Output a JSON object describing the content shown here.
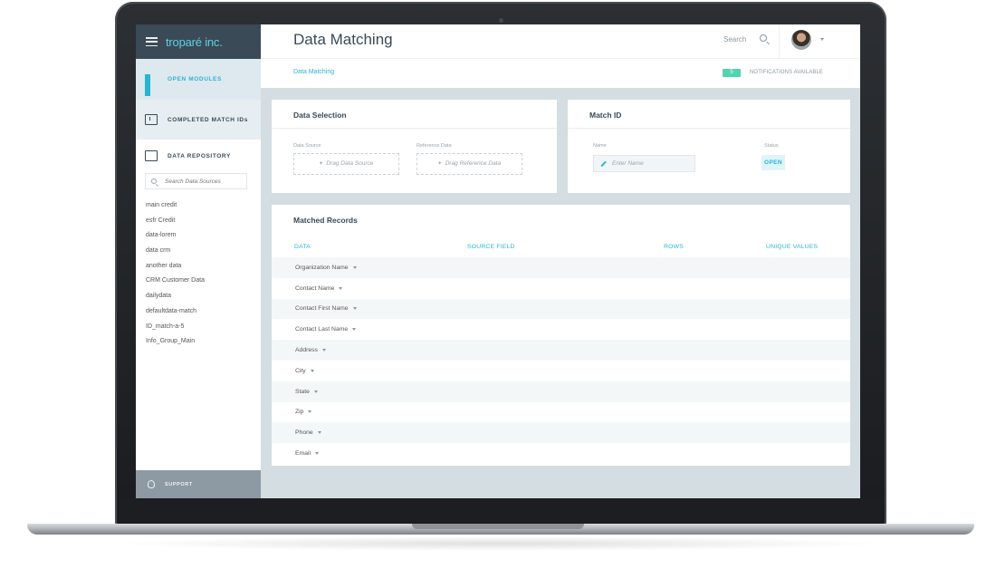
{
  "app": {
    "brand": "troparé inc."
  },
  "sidebar": {
    "modules": [
      {
        "label": "OPEN MODULES"
      },
      {
        "label": "COMPLETED MATCH IDs"
      },
      {
        "label": "DATA REPOSITORY"
      }
    ],
    "search_placeholder": "Search Data Sources",
    "data_sources": [
      "main credit",
      "esfr Credit",
      "data-lorem",
      "data crm",
      "another data",
      "CRM Customer Data",
      "dailydata",
      "defaultdata-match",
      "ID_match-a-5",
      "Info_Group_Main"
    ],
    "support_label": "SUPPORT"
  },
  "header": {
    "title": "Data Matching",
    "search_label": "Search"
  },
  "breadcrumb": {
    "current": "Data Matching",
    "notification_count": "5",
    "notification_text": "NOTIFICATIONS AVAILABLE"
  },
  "data_selection": {
    "title": "Data Selection",
    "source_label": "Data Source",
    "source_drop": "Drag Data Source",
    "reference_label": "Reference Data",
    "reference_drop": "Drag Reference Data"
  },
  "match_id": {
    "title": "Match ID",
    "name_label": "Name",
    "name_placeholder": "Enter Name",
    "status_label": "Status",
    "status_value": "OPEN"
  },
  "matched_records": {
    "title": "Matched Records",
    "columns": [
      "DATA",
      "SOURCE FIELD",
      "ROWS",
      "UNIQUE VALUES"
    ],
    "rows": [
      "Organization Name",
      "Contact Name",
      "Contact First Name",
      "Contact Last Name",
      "Address",
      "City",
      "State",
      "Zip",
      "Phone",
      "Email"
    ]
  },
  "colors": {
    "accent": "#2ab4d1",
    "brand_bar": "#3a4a57",
    "badge": "#4fd6b0"
  }
}
